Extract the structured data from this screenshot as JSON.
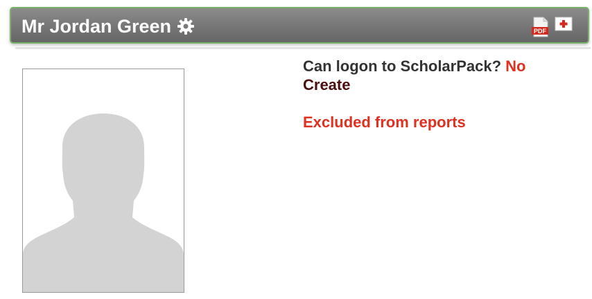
{
  "header": {
    "title": "Mr Jordan Green",
    "settings_icon": "gear-icon",
    "pdf_icon": "pdf-icon",
    "pdf_icon_text": "PDF",
    "add_icon": "add-icon"
  },
  "photo": {
    "icon": "person-silhouette-icon"
  },
  "details": {
    "logon_label": "Can logon to ScholarPack?",
    "logon_value": "No",
    "create_link": "Create",
    "excluded_text": "Excluded from reports"
  },
  "colors": {
    "header_bg": "#787878",
    "header_border": "#79b16a",
    "alert_red": "#e03020",
    "link_dark": "#4a0e0e"
  }
}
